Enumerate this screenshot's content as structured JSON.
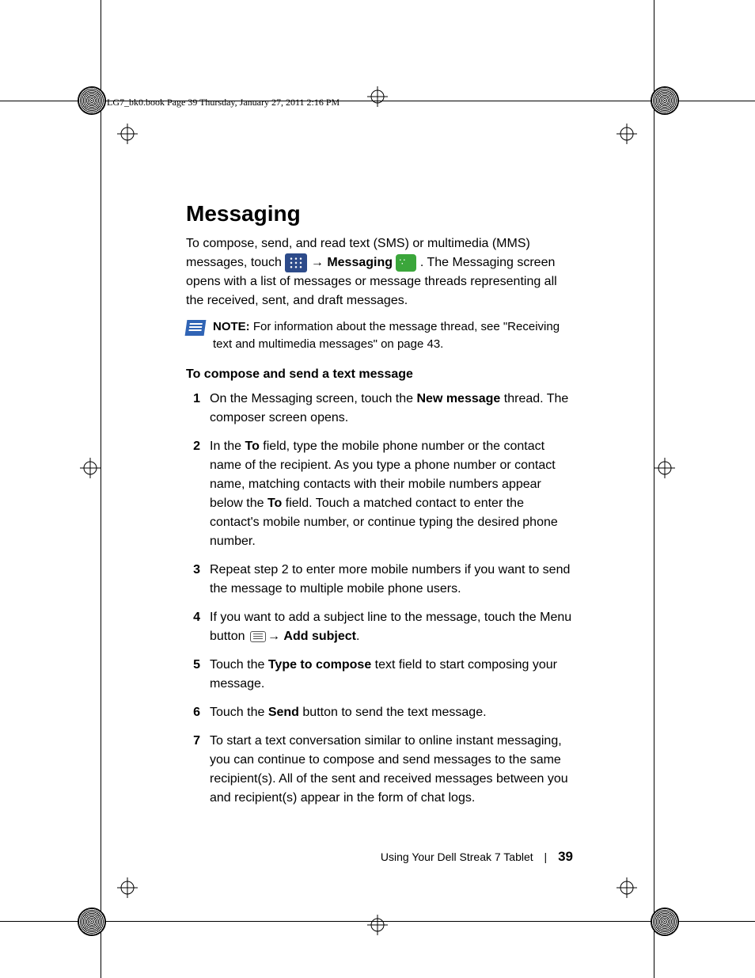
{
  "header": "LG7_bk0.book  Page 39  Thursday, January 27, 2011  2:16 PM",
  "title": "Messaging",
  "intro": {
    "part1": "To compose, send, and read text (SMS) or multimedia (MMS) messages, touch ",
    "messaging_label": "Messaging",
    "part2": ". The Messaging screen opens with a list of messages or message threads representing all the received, sent, and draft messages."
  },
  "note": {
    "label": "NOTE:",
    "text": " For information about the message thread, see \"Receiving text and multimedia messages\" on page 43."
  },
  "subhead": "To compose and send a text message",
  "steps": [
    {
      "num": "1",
      "parts": [
        {
          "t": "On the Messaging screen, touch the "
        },
        {
          "b": "New message"
        },
        {
          "t": " thread. The composer screen opens."
        }
      ]
    },
    {
      "num": "2",
      "parts": [
        {
          "t": "In the "
        },
        {
          "b": "To"
        },
        {
          "t": " field, type the mobile phone number or the contact name of the recipient. As you type a phone number or contact name, matching contacts with their mobile numbers appear below the "
        },
        {
          "b": "To"
        },
        {
          "t": " field. Touch a matched contact to enter the contact's mobile number, or continue typing the desired phone number."
        }
      ]
    },
    {
      "num": "3",
      "parts": [
        {
          "t": "Repeat step 2 to enter more mobile numbers if you want to send the message to multiple mobile phone users."
        }
      ]
    },
    {
      "num": "4",
      "parts": [
        {
          "t": "If you want to add a subject line to the message, touch the Menu button "
        },
        {
          "icon": "menu"
        },
        {
          "t": "→ "
        },
        {
          "b": "Add subject"
        },
        {
          "t": "."
        }
      ]
    },
    {
      "num": "5",
      "parts": [
        {
          "t": "Touch the "
        },
        {
          "b": "Type to compose"
        },
        {
          "t": " text field to start composing your message."
        }
      ]
    },
    {
      "num": "6",
      "parts": [
        {
          "t": "Touch the "
        },
        {
          "b": "Send"
        },
        {
          "t": " button to send the text message."
        }
      ]
    },
    {
      "num": "7",
      "parts": [
        {
          "t": "To start a text conversation similar to online instant messaging, you can continue to compose and send messages to the same recipient(s). All of the sent and received messages between you and recipient(s) appear in the form of chat logs."
        }
      ]
    }
  ],
  "footer": {
    "book": "Using Your Dell Streak 7 Tablet",
    "page": "39"
  }
}
